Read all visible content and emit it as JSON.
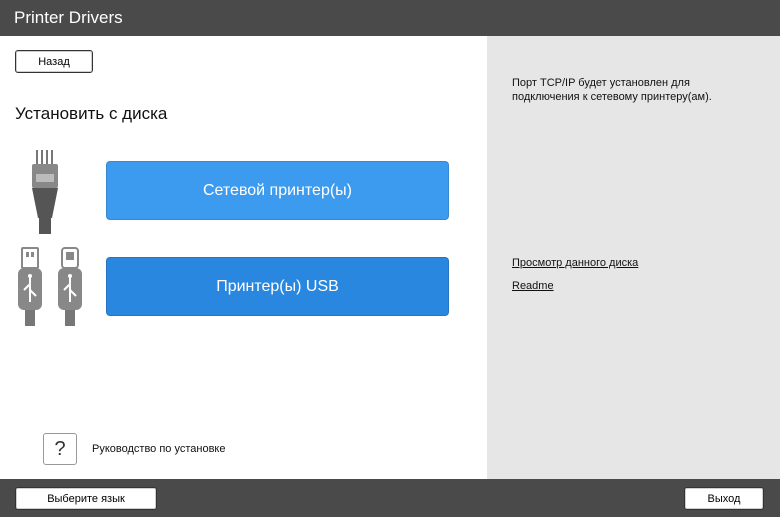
{
  "app": {
    "title": "Printer Drivers"
  },
  "nav": {
    "back_label": "Назад"
  },
  "main": {
    "heading": "Установить с диска",
    "network_button": "Сетевой принтер(ы)",
    "usb_button": "Принтер(ы) USB",
    "network_icon": "ethernet-cable-icon",
    "usb_icon": "usb-cable-icon",
    "help_icon_glyph": "?",
    "help_label": "Руководство по установке"
  },
  "side": {
    "info": "Порт TCP/IP будет установлен для подключения к сетевому принтеру(ам).",
    "view_disc_link": "Просмотр данного диска",
    "readme_link": "Readme"
  },
  "footer": {
    "language_label": "Выберите язык",
    "exit_label": "Выход"
  },
  "colors": {
    "bar": "#4a4a4a",
    "panel": "#e6e6e6",
    "network_button": "#3d9bef",
    "usb_button": "#2a87e0"
  }
}
